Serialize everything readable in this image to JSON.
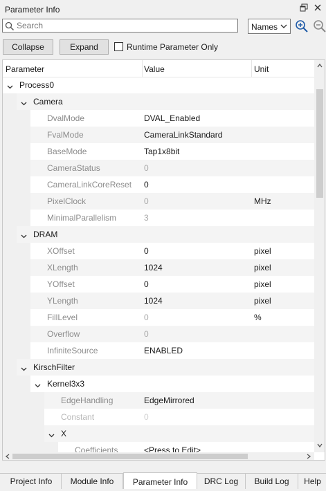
{
  "window": {
    "title": "Parameter Info"
  },
  "search": {
    "placeholder": "Search",
    "mode": "Names"
  },
  "toolbar": {
    "collapse_label": "Collapse",
    "expand_label": "Expand",
    "runtime_only_label": "Runtime Parameter Only",
    "runtime_only_checked": false
  },
  "grid": {
    "columns": [
      "Parameter",
      "Value",
      "Unit"
    ],
    "rows": [
      {
        "name": "Process0",
        "value": "",
        "unit": "",
        "level": 0,
        "group": true
      },
      {
        "name": "Camera",
        "value": "",
        "unit": "",
        "level": 1,
        "group": true
      },
      {
        "name": "DvalMode",
        "value": "DVAL_Enabled",
        "unit": "",
        "level": 2,
        "readonly": false
      },
      {
        "name": "FvalMode",
        "value": "CameraLinkStandard",
        "unit": "",
        "level": 2,
        "readonly": false
      },
      {
        "name": "BaseMode",
        "value": "Tap1x8bit",
        "unit": "",
        "level": 2,
        "readonly": false
      },
      {
        "name": "CameraStatus",
        "value": "0",
        "unit": "",
        "level": 2,
        "readonly": true
      },
      {
        "name": "CameraLinkCoreReset",
        "value": "0",
        "unit": "",
        "level": 2,
        "readonly": false
      },
      {
        "name": "PixelClock",
        "value": "0",
        "unit": "MHz",
        "level": 2,
        "readonly": true
      },
      {
        "name": "MinimalParallelism",
        "value": "3",
        "unit": "",
        "level": 2,
        "readonly": true
      },
      {
        "name": "DRAM",
        "value": "",
        "unit": "",
        "level": 1,
        "group": true
      },
      {
        "name": "XOffset",
        "value": "0",
        "unit": "pixel",
        "level": 2,
        "readonly": false
      },
      {
        "name": "XLength",
        "value": "1024",
        "unit": "pixel",
        "level": 2,
        "readonly": false
      },
      {
        "name": "YOffset",
        "value": "0",
        "unit": "pixel",
        "level": 2,
        "readonly": false
      },
      {
        "name": "YLength",
        "value": "1024",
        "unit": "pixel",
        "level": 2,
        "readonly": false
      },
      {
        "name": "FillLevel",
        "value": "0",
        "unit": "%",
        "level": 2,
        "readonly": true
      },
      {
        "name": "Overflow",
        "value": "0",
        "unit": "",
        "level": 2,
        "readonly": true
      },
      {
        "name": "InfiniteSource",
        "value": "ENABLED",
        "unit": "",
        "level": 2,
        "readonly": false
      },
      {
        "name": "KirschFilter",
        "value": "",
        "unit": "",
        "level": 1,
        "group": true
      },
      {
        "name": "Kernel3x3",
        "value": "",
        "unit": "",
        "level": 2,
        "group": true
      },
      {
        "name": "EdgeHandling",
        "value": "EdgeMirrored",
        "unit": "",
        "level": 3,
        "readonly": false
      },
      {
        "name": "Constant",
        "value": "0",
        "unit": "",
        "level": 3,
        "readonly": true,
        "faint": true
      },
      {
        "name": "X",
        "value": "",
        "unit": "",
        "level": 3,
        "group": true
      },
      {
        "name": "Coefficients",
        "value": "<Press to Edit>",
        "unit": "",
        "level": 4,
        "readonly": false
      }
    ]
  },
  "tabs": [
    {
      "label": "Project Info",
      "active": false
    },
    {
      "label": "Module Info",
      "active": false
    },
    {
      "label": "Parameter Info",
      "active": true
    },
    {
      "label": "DRC Log",
      "active": false
    },
    {
      "label": "Build Log",
      "active": false
    },
    {
      "label": "Help",
      "active": false
    }
  ],
  "colors": {
    "accent": "#1e5aa8",
    "readonly_text": "#8c8c8c"
  },
  "icons": [
    "pin-icon",
    "close-icon",
    "search-icon",
    "chevron-down-icon",
    "zoom-in-icon",
    "zoom-out-icon"
  ]
}
